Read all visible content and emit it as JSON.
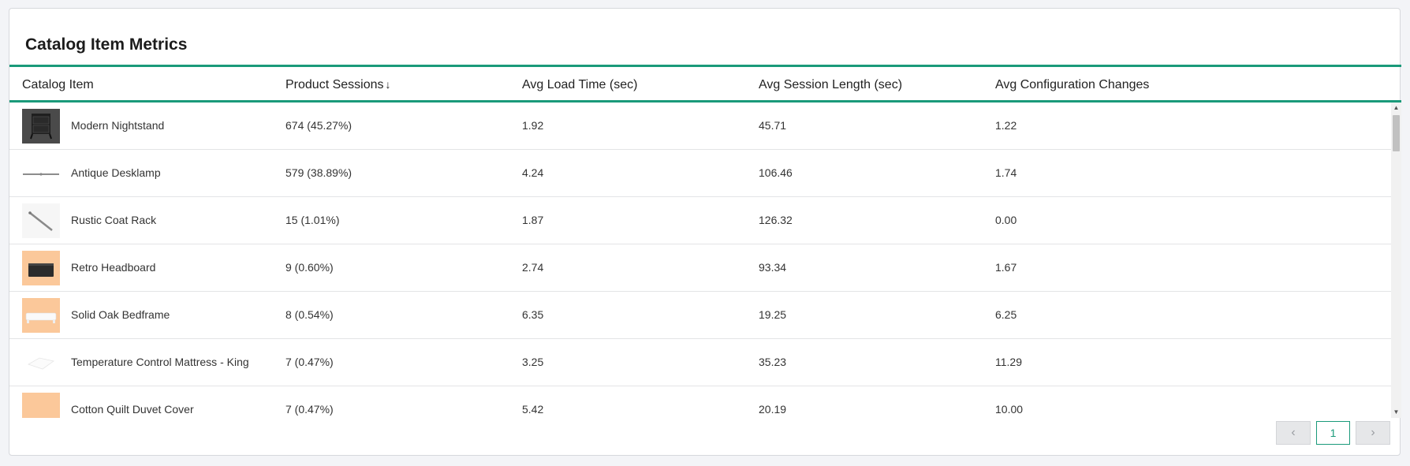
{
  "card": {
    "title": "Catalog Item Metrics"
  },
  "columns": [
    {
      "label": "Catalog Item"
    },
    {
      "label": "Product Sessions",
      "sort_icon": "arrow-down-icon"
    },
    {
      "label": "Avg Load Time (sec)"
    },
    {
      "label": "Avg Session Length (sec)"
    },
    {
      "label": "Avg Configuration Changes"
    }
  ],
  "rows": [
    {
      "item": "Modern Nightstand",
      "sessions": "674 (45.27%)",
      "load": "1.92",
      "length": "45.71",
      "changes": "1.22"
    },
    {
      "item": "Antique Desklamp",
      "sessions": "579 (38.89%)",
      "load": "4.24",
      "length": "106.46",
      "changes": "1.74"
    },
    {
      "item": "Rustic Coat Rack",
      "sessions": "15 (1.01%)",
      "load": "1.87",
      "length": "126.32",
      "changes": "0.00"
    },
    {
      "item": "Retro Headboard",
      "sessions": "9 (0.60%)",
      "load": "2.74",
      "length": "93.34",
      "changes": "1.67"
    },
    {
      "item": "Solid Oak Bedframe",
      "sessions": "8 (0.54%)",
      "load": "6.35",
      "length": "19.25",
      "changes": "6.25"
    },
    {
      "item": "Temperature Control Mattress - King",
      "sessions": "7 (0.47%)",
      "load": "3.25",
      "length": "35.23",
      "changes": "11.29"
    },
    {
      "item": "Cotton Quilt Duvet Cover",
      "sessions": "7 (0.47%)",
      "load": "5.42",
      "length": "20.19",
      "changes": "10.00"
    }
  ],
  "pagination": {
    "prev_icon": "chevron-left-icon",
    "current_page": "1",
    "next_icon": "chevron-right-icon"
  },
  "colors": {
    "accent": "#1a9a7a",
    "thumb_peach": "#fbc89a"
  }
}
